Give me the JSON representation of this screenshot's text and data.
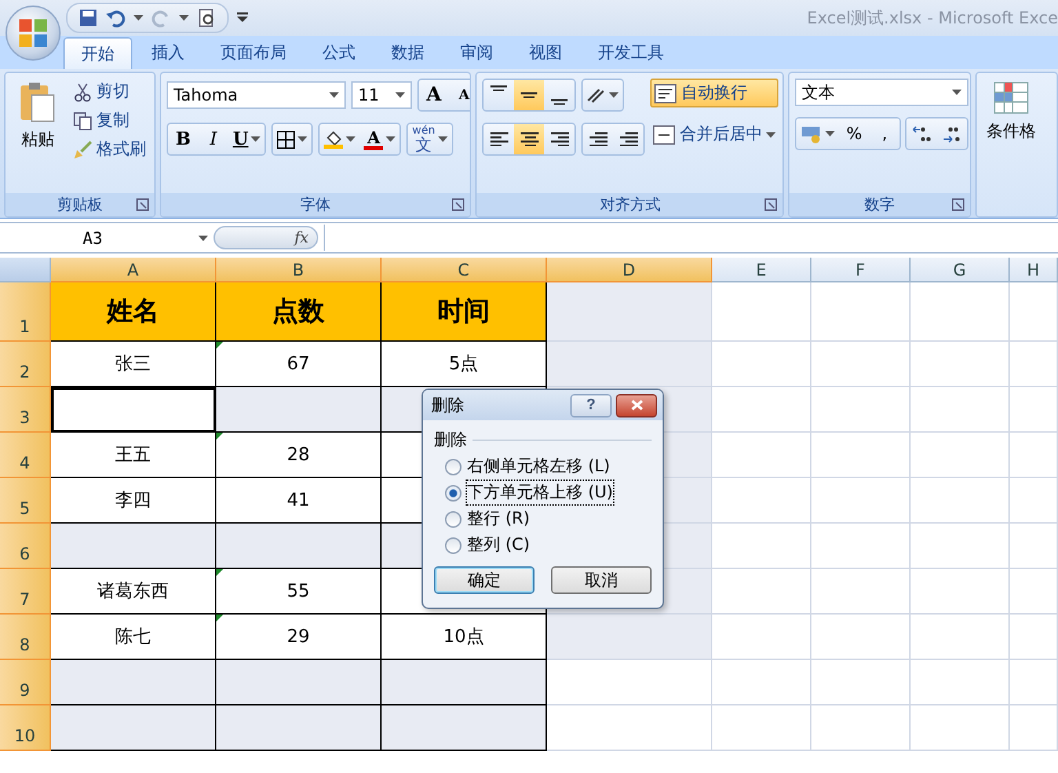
{
  "window": {
    "title": "Excel测试.xlsx - Microsoft Exce"
  },
  "tabs": [
    {
      "label": "开始",
      "selected": true
    },
    {
      "label": "插入",
      "selected": false
    },
    {
      "label": "页面布局",
      "selected": false
    },
    {
      "label": "公式",
      "selected": false
    },
    {
      "label": "数据",
      "selected": false
    },
    {
      "label": "审阅",
      "selected": false
    },
    {
      "label": "视图",
      "selected": false
    },
    {
      "label": "开发工具",
      "selected": false
    }
  ],
  "ribbon": {
    "clipboard": {
      "title": "剪贴板",
      "paste": "粘贴",
      "cut": "剪切",
      "copy": "复制",
      "format_painter": "格式刷"
    },
    "font": {
      "title": "字体",
      "font_name": "Tahoma",
      "font_size": "11",
      "grow": "A",
      "shrink": "A",
      "bold": "B",
      "italic": "I",
      "underline": "U",
      "font_color": "A",
      "phonetic_ruby": "wén",
      "phonetic_char": "文"
    },
    "alignment": {
      "title": "对齐方式",
      "top_align_selected": false,
      "middle_align_selected": true,
      "center_selected": true,
      "wrap_text": {
        "label": "自动换行",
        "selected": true
      },
      "merge_center": "合并后居中"
    },
    "number": {
      "title": "数字",
      "format": "文本",
      "percent": "%",
      "comma": ","
    },
    "styles": {
      "conditional_format": "条件格"
    }
  },
  "formula_bar": {
    "name_box": "A3",
    "fx": "fx"
  },
  "sheet": {
    "columns": [
      {
        "label": "A",
        "selected": true
      },
      {
        "label": "B",
        "selected": true
      },
      {
        "label": "C",
        "selected": true
      },
      {
        "label": "D",
        "selected": true
      },
      {
        "label": "E",
        "selected": false
      },
      {
        "label": "F",
        "selected": false
      },
      {
        "label": "G",
        "selected": false
      },
      {
        "label": "H",
        "selected": false
      }
    ],
    "rows": [
      {
        "label": "1",
        "kind": "header",
        "cells": [
          {
            "text": "姓名"
          },
          {
            "text": "点数"
          },
          {
            "text": "时间"
          },
          {
            "selected": true
          }
        ]
      },
      {
        "label": "2",
        "kind": "data",
        "cells": [
          {
            "text": "张三",
            "selected": false
          },
          {
            "text": "67",
            "selected": false,
            "flag": true
          },
          {
            "text": "5点",
            "selected": false
          },
          {
            "selected": true
          }
        ]
      },
      {
        "label": "3",
        "kind": "data",
        "cells": [
          {
            "selected": false,
            "active": true
          },
          {
            "selected": true
          },
          {
            "selected": true
          },
          {
            "selected": true
          }
        ]
      },
      {
        "label": "4",
        "kind": "data",
        "cells": [
          {
            "text": "王五",
            "selected": false
          },
          {
            "text": "28",
            "selected": false,
            "flag": true
          },
          {
            "selected": false
          },
          {
            "selected": true
          }
        ]
      },
      {
        "label": "5",
        "kind": "data",
        "cells": [
          {
            "text": "李四",
            "selected": false
          },
          {
            "text": "41",
            "selected": false
          },
          {
            "selected": false
          },
          {
            "selected": true
          }
        ]
      },
      {
        "label": "6",
        "kind": "data",
        "cells": [
          {
            "selected": true
          },
          {
            "selected": true
          },
          {
            "selected": true
          },
          {
            "selected": true
          }
        ]
      },
      {
        "label": "7",
        "kind": "data",
        "cells": [
          {
            "text": "诸葛东西",
            "selected": false
          },
          {
            "text": "55",
            "selected": false,
            "flag": true
          },
          {
            "selected": false
          },
          {
            "selected": true
          }
        ]
      },
      {
        "label": "8",
        "kind": "data",
        "cells": [
          {
            "text": "陈七",
            "selected": false
          },
          {
            "text": "29",
            "selected": false,
            "flag": true
          },
          {
            "text": "10点",
            "selected": false
          },
          {
            "selected": true
          }
        ]
      },
      {
        "label": "9",
        "kind": "data",
        "cells": [
          {
            "selected": true
          },
          {
            "selected": true
          },
          {
            "selected": true
          },
          {
            "selected": false
          }
        ]
      },
      {
        "label": "10",
        "kind": "data",
        "cells": [
          {
            "selected": true
          },
          {
            "selected": true
          },
          {
            "selected": true
          },
          {
            "selected": false
          }
        ]
      }
    ]
  },
  "dialog": {
    "title": "删除",
    "help": "?",
    "group_label": "删除",
    "options": [
      {
        "label": "右侧单元格左移 (L)",
        "selected": false
      },
      {
        "label": "下方单元格上移 (U)",
        "selected": true
      },
      {
        "label": "整行 (R)",
        "selected": false
      },
      {
        "label": "整列 (C)",
        "selected": false
      }
    ],
    "buttons": [
      {
        "label": "确定",
        "default": true
      },
      {
        "label": "取消",
        "default": false
      }
    ]
  }
}
